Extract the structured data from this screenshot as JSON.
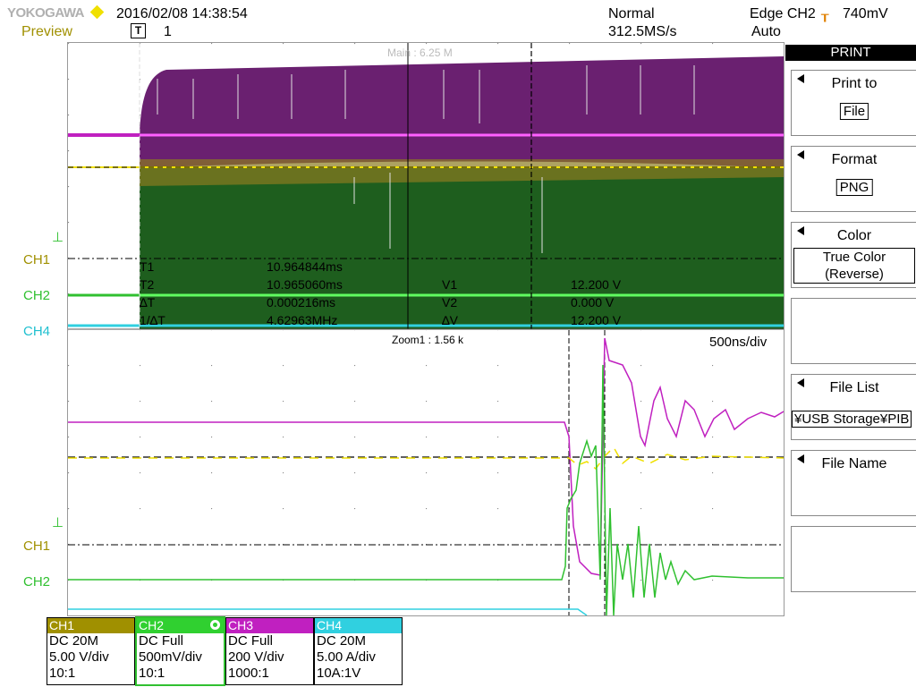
{
  "header": {
    "brand": "YOKOGAWA",
    "datetime": "2016/02/08 14:38:54",
    "status": "Preview",
    "trigger_pos_label": "1",
    "acq_mode": "Normal",
    "sample_rate": "312.5MS/s",
    "trigger": "Edge CH2",
    "trigger_level": "740mV",
    "trigger_mode": "Auto",
    "trigger_pos_icon": "T"
  },
  "main_window": {
    "label": "Main : 6.25 M",
    "cursor": {
      "t1_label": "T1",
      "t1_value": "10.964844ms",
      "t2_label": "T2",
      "t2_value": "10.965060ms",
      "dt_label": "∆T",
      "dt_value": "0.000216ms",
      "inv_label": "1/∆T",
      "inv_value": "4.62963MHz",
      "v1_label": "V1",
      "v1_value": "12.200 V",
      "v2_label": "V2",
      "v2_value": "0.000 V",
      "dv_label": "∆V",
      "dv_value": "12.200 V"
    }
  },
  "zoom_window": {
    "label": "Zoom1 : 1.56 k",
    "timebase": "500ns/div"
  },
  "channel_labels": {
    "ch1": "CH1",
    "ch2": "CH2",
    "ch3": "CH3",
    "ch4": "CH4"
  },
  "menu": {
    "title": "PRINT",
    "items": [
      {
        "label": "Print to",
        "value": "File"
      },
      {
        "label": "Format",
        "value": "PNG"
      },
      {
        "label": "Color",
        "value": "True Color\n(Reverse)"
      },
      {
        "label": "",
        "value": ""
      },
      {
        "label": "File List",
        "value": "¥USB Storage¥PIB"
      },
      {
        "label": "File Name",
        "value": ""
      },
      {
        "label": "",
        "value": ""
      }
    ]
  },
  "channels": [
    {
      "name": "CH1",
      "coupling": "DC 20M",
      "scale": "5.00 V/div",
      "probe": "10:1",
      "color": "#a09000"
    },
    {
      "name": "CH2",
      "coupling": "DC Full",
      "scale": "500mV/div",
      "probe": "10:1",
      "color": "#30d030"
    },
    {
      "name": "CH3",
      "coupling": "DC Full",
      "scale": "200 V/div",
      "probe": "1000:1",
      "color": "#c020c0"
    },
    {
      "name": "CH4",
      "coupling": "DC 20M",
      "scale": "5.00 A/div",
      "probe": "10A:1V",
      "color": "#30d0e0"
    }
  ],
  "colors": {
    "ch1": "#c0b000",
    "ch2": "#30d030",
    "ch3": "#c020c0",
    "ch4": "#30d0e0",
    "accent_diamond": "#f0e000"
  }
}
